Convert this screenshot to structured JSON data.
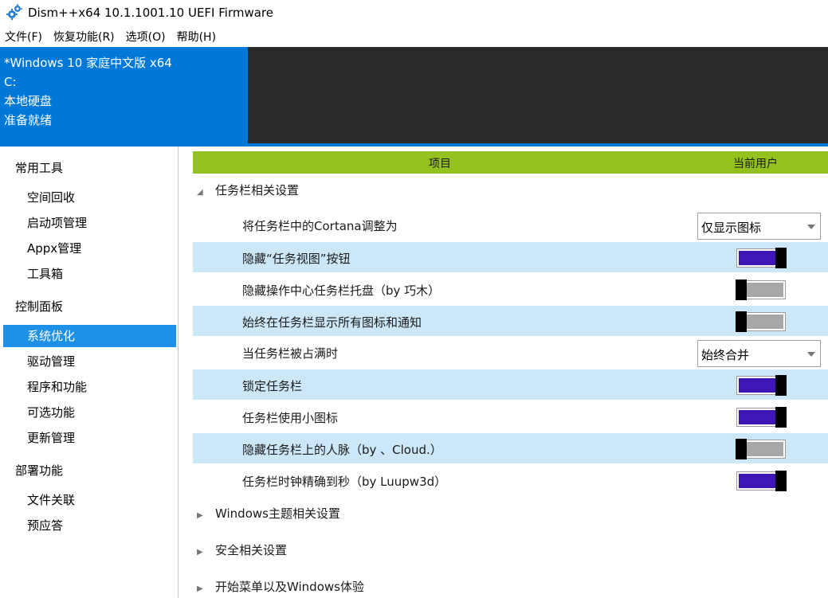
{
  "window": {
    "title": "Dism++x64 10.1.1001.10 UEFI Firmware",
    "icon": "gears-icon"
  },
  "menu": [
    {
      "label": "文件(F)"
    },
    {
      "label": "恢复功能(R)"
    },
    {
      "label": "选项(O)"
    },
    {
      "label": "帮助(H)"
    }
  ],
  "image_panel": {
    "os": "*Windows 10 家庭中文版 x64",
    "drive": "C:",
    "disk": "本地硬盘",
    "status": "准备就绪"
  },
  "sidebar": {
    "groups": [
      {
        "label": "常用工具",
        "items": [
          "空间回收",
          "启动项管理",
          "Appx管理",
          "工具箱"
        ]
      },
      {
        "label": "控制面板",
        "items": [
          "系统优化",
          "驱动管理",
          "程序和功能",
          "可选功能",
          "更新管理"
        ]
      },
      {
        "label": "部署功能",
        "items": [
          "文件关联",
          "预应答"
        ]
      }
    ],
    "selected": "系统优化"
  },
  "table": {
    "col_item": "项目",
    "col_user": "当前用户"
  },
  "section_taskbar": {
    "title": "任务栏相关设置",
    "expanded": true,
    "rows": [
      {
        "label": "将任务栏中的Cortana调整为",
        "type": "select",
        "value": "仅显示图标"
      },
      {
        "label": "隐藏“任务视图”按钮",
        "type": "toggle",
        "on": true
      },
      {
        "label": "隐藏操作中心任务栏托盘（by 巧木）",
        "type": "toggle",
        "on": false
      },
      {
        "label": "始终在任务栏显示所有图标和通知",
        "type": "toggle",
        "on": false
      },
      {
        "label": "当任务栏被占满时",
        "type": "select",
        "value": "始终合并"
      },
      {
        "label": "锁定任务栏",
        "type": "toggle",
        "on": true
      },
      {
        "label": "任务栏使用小图标",
        "type": "toggle",
        "on": true
      },
      {
        "label": "隐藏任务栏上的人脉（by 、Cloud.）",
        "type": "toggle",
        "on": false
      },
      {
        "label": "任务栏时钟精确到秒（by Luupw3d）",
        "type": "toggle",
        "on": true
      }
    ]
  },
  "collapsed_sections": [
    {
      "title": "Windows主题相关设置"
    },
    {
      "title": "安全相关设置"
    },
    {
      "title": "开始菜单以及Windows体验"
    }
  ],
  "colors": {
    "accent_blue": "#0078d7",
    "selected_item": "#1e90e6",
    "header_green": "#95c11f",
    "row_shade": "#cce8f8",
    "toggle_on": "#3f17b7",
    "toggle_off": "#a8a8a8"
  }
}
